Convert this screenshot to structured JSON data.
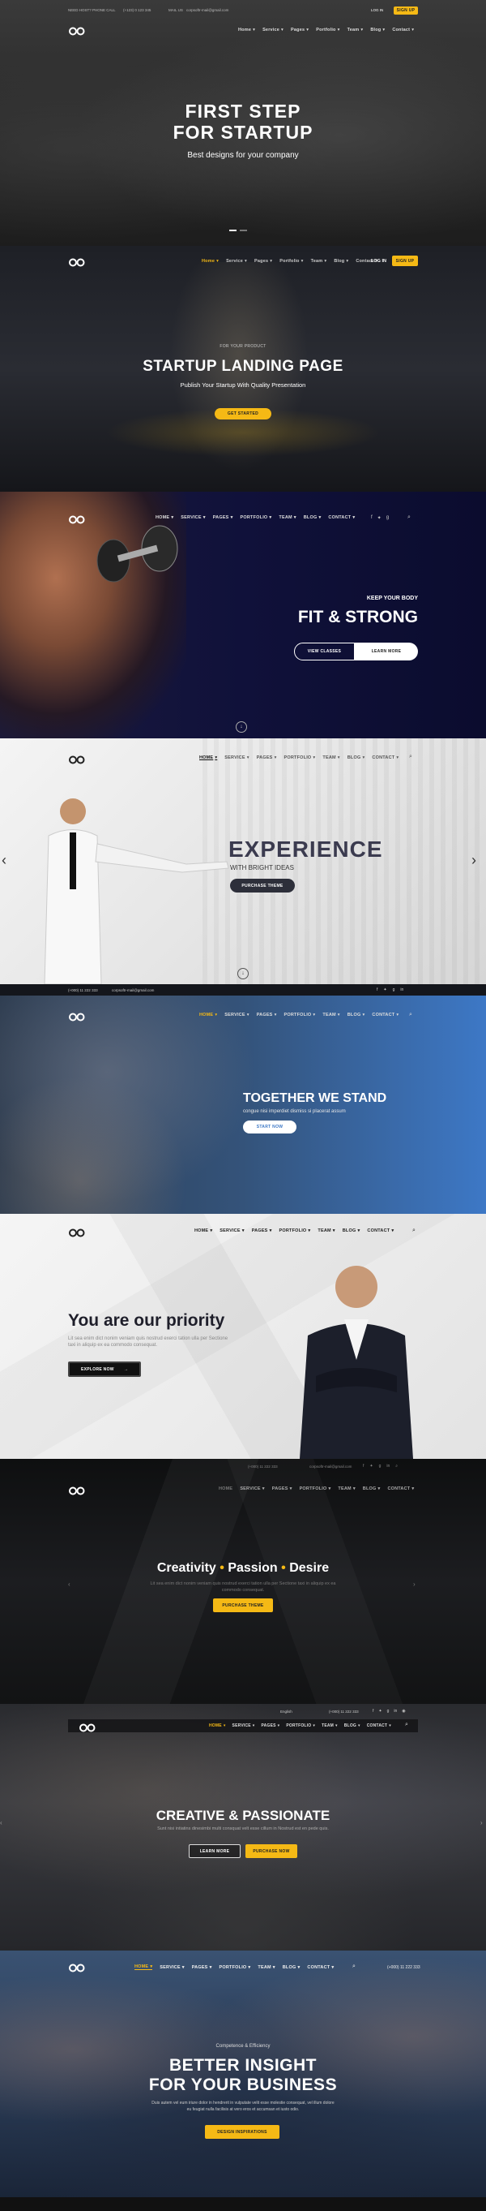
{
  "s1": {
    "topbar": {
      "phone_label": "NEED HOST? PHONE CALL",
      "phone": "(+123) 0 123 345",
      "mail_label": "MAIL US",
      "mail": "corpsoftr-mail@gmail.com",
      "login": "LOG IN",
      "cta": "SIGN UP"
    },
    "nav": [
      "Home",
      "Service",
      "Pages",
      "Portfolio",
      "Team",
      "Blog",
      "Contact"
    ],
    "title_1": "FIRST STEP",
    "title_2": "FOR STARTUP",
    "subtitle": "Best designs for your company"
  },
  "s2": {
    "nav": [
      "Home",
      "Service",
      "Pages",
      "Portfolio",
      "Team",
      "Blog",
      "Contact"
    ],
    "login": "LOG IN",
    "cta": "SIGN UP",
    "eyebrow": "FOR YOUR PRODUCT",
    "title": "STARTUP LANDING PAGE",
    "subtitle": "Publish Your Startup With Quality Presentation",
    "button": "GET STARTED"
  },
  "s3": {
    "nav": [
      "HOME",
      "SERVICE",
      "PAGES",
      "PORTFOLIO",
      "TEAM",
      "BLOG",
      "CONTACT"
    ],
    "eyebrow": "KEEP YOUR BODY",
    "title": "FIT & STRONG",
    "btn1": "VIEW CLASSES",
    "btn2": "LEARN MORE"
  },
  "s4": {
    "nav": [
      "HOME",
      "SERVICE",
      "PAGES",
      "PORTFOLIO",
      "TEAM",
      "BLOG",
      "CONTACT"
    ],
    "title": "EXPERIENCE",
    "subtitle": "WITH BRIGHT IDEAS",
    "button": "PURCHASE THEME"
  },
  "s5": {
    "phone": "(+000) 11 222 333",
    "mail": "corpsoftr-mail@gmail.com",
    "nav": [
      "HOME",
      "SERVICE",
      "PAGES",
      "PORTFOLIO",
      "TEAM",
      "BLOG",
      "CONTACT"
    ],
    "title": "TOGETHER WE STAND",
    "subtitle": "congue nisi imperdiet dismiss si placerat assum",
    "button": "START NOW"
  },
  "s6": {
    "nav": [
      "HOME",
      "SERVICE",
      "PAGES",
      "PORTFOLIO",
      "TEAM",
      "BLOG",
      "CONTACT"
    ],
    "title": "You are our priority",
    "body": "Lit sea enim dict nonim veniam quis nostrud exerci tation ulla per Sectione taxi in aliquip ex ea commodo consequat.",
    "button": "EXPLORE NOW"
  },
  "s7": {
    "phone": "(+000) 11 222 333",
    "mail": "corpsoftr-mail@gmail.com",
    "nav": [
      "HOME",
      "SERVICE",
      "PAGES",
      "PORTFOLIO",
      "TEAM",
      "BLOG",
      "CONTACT"
    ],
    "w1": "Creativity",
    "w2": "Passion",
    "w3": "Desire",
    "body": "Lit sea enim dict nonim veniam quis nostrud exerci tation ulla per Sectione taxi in aliquip ex ea commodo consequat.",
    "button": "PURCHASE THEME"
  },
  "s8": {
    "lang": "English",
    "phone": "(+000) 11 222 333",
    "nav": [
      "HOME",
      "SERVICE",
      "PAGES",
      "PORTFOLIO",
      "TEAM",
      "BLOG",
      "CONTACT"
    ],
    "title": "CREATIVE & PASSIONATE",
    "body": "Sunt nisi intiatins dinesimbi multi consquat velt esse cillum in Nostrud est en pede quis.",
    "btn1": "LEARN MORE",
    "btn2": "PURCHASE NOW"
  },
  "s9": {
    "nav": [
      "HOME",
      "SERVICE",
      "PAGES",
      "PORTFOLIO",
      "TEAM",
      "BLOG",
      "CONTACT"
    ],
    "phone": "(+000) 11 222 333",
    "eyebrow": "Competence & Efficiency",
    "title_1": "BETTER INSIGHT",
    "title_2": "FOR YOUR BUSINESS",
    "body": "Duis autem vel eum iriure dolor in hendrerit in vulputate velit esse molestie consequat, vel illum dolore eu feugiat nulla facilisis at vero eros et accumsan et iusto odio.",
    "button": "DESIGN INSPIRATIONS"
  },
  "colors": {
    "accent": "#f5b915",
    "dark_navy": "#14163f",
    "blue": "#3d78c6"
  }
}
